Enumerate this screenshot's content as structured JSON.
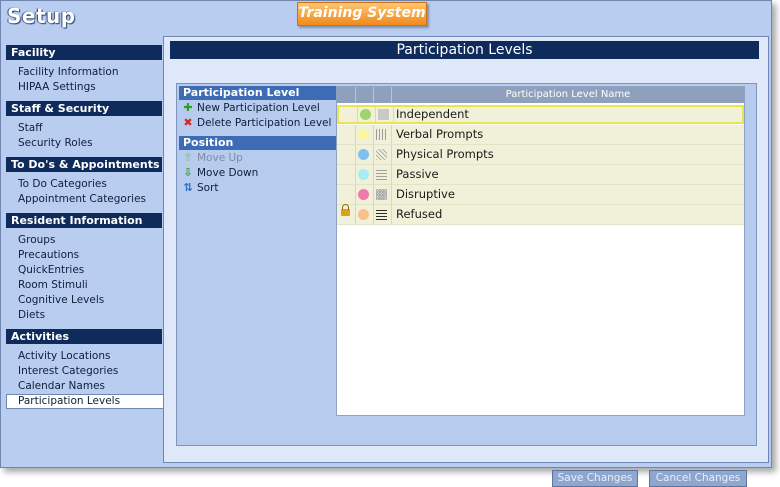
{
  "app": {
    "title": "Setup",
    "brand": "Training System"
  },
  "sidebar": {
    "sections": [
      {
        "title": "Facility",
        "items": [
          "Facility Information",
          "HIPAA Settings"
        ]
      },
      {
        "title": "Staff & Security",
        "items": [
          "Staff",
          "Security Roles"
        ]
      },
      {
        "title": "To Do's & Appointments",
        "items": [
          "To Do Categories",
          "Appointment Categories"
        ]
      },
      {
        "title": "Resident Information",
        "items": [
          "Groups",
          "Precautions",
          "QuickEntries",
          "Room Stimuli",
          "Cognitive Levels",
          "Diets"
        ]
      },
      {
        "title": "Activities",
        "items": [
          "Activity Locations",
          "Interest Categories",
          "Calendar Names",
          "Participation Levels"
        ]
      }
    ],
    "active_item": "Participation Levels"
  },
  "main": {
    "title": "Participation Levels",
    "left_panel": {
      "participation_header": "Participation Level",
      "new_label": "New Participation Level",
      "delete_label": "Delete Participation Level",
      "position_header": "Position",
      "move_up_label": "Move Up",
      "move_down_label": "Move Down",
      "sort_label": "Sort"
    },
    "grid": {
      "column_header": "Participation Level Name",
      "rows": [
        {
          "name": "Independent",
          "color": "#9ed36f",
          "pattern": "solid-gray",
          "locked": false,
          "selected": true
        },
        {
          "name": "Verbal Prompts",
          "color": "#fbf7a0",
          "pattern": "vertical-lines",
          "locked": false,
          "selected": false
        },
        {
          "name": "Physical Prompts",
          "color": "#7fc0ee",
          "pattern": "diagonal-lines",
          "locked": false,
          "selected": false
        },
        {
          "name": "Passive",
          "color": "#a9ecf5",
          "pattern": "horizontal-lines",
          "locked": false,
          "selected": false
        },
        {
          "name": "Disruptive",
          "color": "#f07ba8",
          "pattern": "crosshatch",
          "locked": false,
          "selected": false
        },
        {
          "name": "Refused",
          "color": "#f9c08e",
          "pattern": "dense-horizontal-lines",
          "locked": true,
          "selected": false
        }
      ]
    },
    "buttons": {
      "save": "Save Changes",
      "cancel": "Cancel Changes"
    }
  },
  "icons": {
    "new": "plus-icon",
    "delete": "x-icon",
    "move_up": "arrow-up-icon",
    "move_down": "arrow-down-icon",
    "sort": "sort-icon",
    "lock": "lock-icon"
  }
}
